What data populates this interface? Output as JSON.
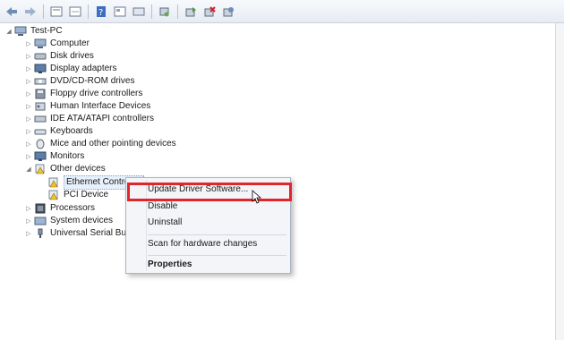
{
  "toolbar": {
    "buttons": [
      "back-icon",
      "forward-icon",
      "properties-icon",
      "help-icon",
      "show-hidden-icon",
      "scan-hardware-icon",
      "update-driver-icon",
      "uninstall-icon",
      "disable-icon"
    ]
  },
  "tree": {
    "root": "Test-PC",
    "categories": [
      "Computer",
      "Disk drives",
      "Display adapters",
      "DVD/CD-ROM drives",
      "Floppy drive controllers",
      "Human Interface Devices",
      "IDE ATA/ATAPI controllers",
      "Keyboards",
      "Mice and other pointing devices",
      "Monitors",
      "Other devices",
      "Processors",
      "System devices",
      "Universal Serial Bus"
    ],
    "other_devices_children": [
      "Ethernet Controller",
      "PCI Device"
    ]
  },
  "context_menu": {
    "update_driver": "Update Driver Software...",
    "disable": "Disable",
    "uninstall": "Uninstall",
    "scan": "Scan for hardware changes",
    "properties": "Properties"
  },
  "colors": {
    "highlight_border": "#e0262b",
    "warning": "#f2c12e"
  }
}
